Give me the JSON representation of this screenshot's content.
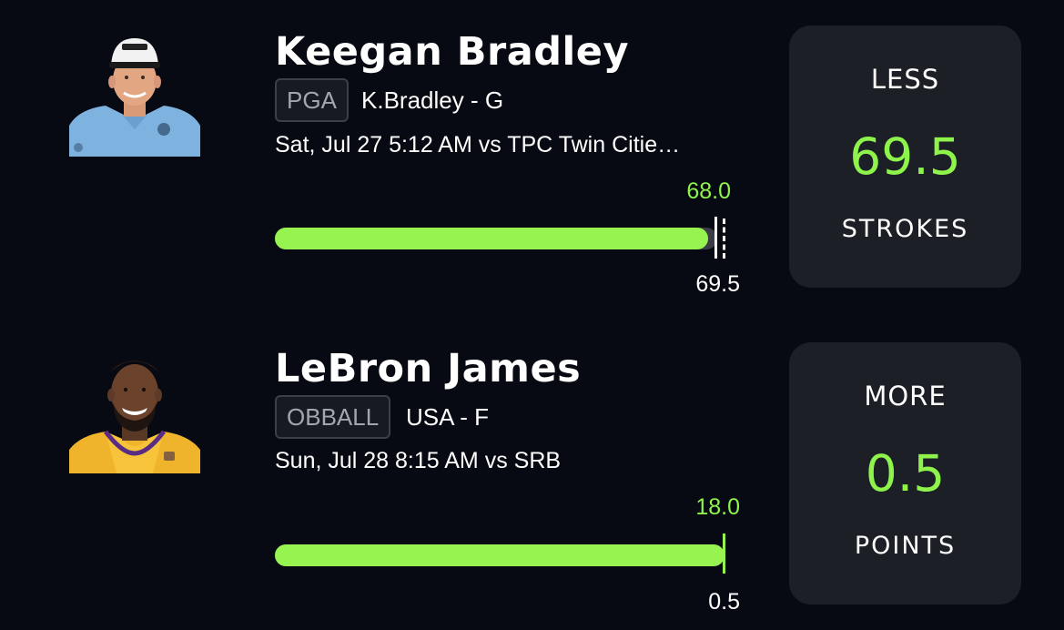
{
  "theme": {
    "background": "#070a12",
    "card": "#1c1f26",
    "accent": "#97f34f",
    "track": "#3a3d45",
    "badge_border": "#3b3f47"
  },
  "picks": [
    {
      "player_name": "Keegan Bradley",
      "league": "PGA",
      "team_position": "K.Bradley - G",
      "game_info": "Sat, Jul 27 5:12 AM  vs TPC Twin Citie…",
      "current_score": "68.0",
      "line": "69.5",
      "progress_fraction": 0.98,
      "marker_style": "dashed",
      "pick_direction": "LESS",
      "pick_line": "69.5",
      "pick_unit": "STROKES",
      "avatar_icon": "golfer-headshot-icon"
    },
    {
      "player_name": "LeBron James",
      "league": "OBBALL",
      "team_position": "USA - F",
      "game_info": "Sun, Jul 28 8:15 AM  vs SRB",
      "current_score": "18.0",
      "line": "0.5",
      "progress_fraction": 1.0,
      "marker_style": "solid",
      "pick_direction": "MORE",
      "pick_line": "0.5",
      "pick_unit": "POINTS",
      "avatar_icon": "basketball-player-headshot-icon"
    }
  ]
}
